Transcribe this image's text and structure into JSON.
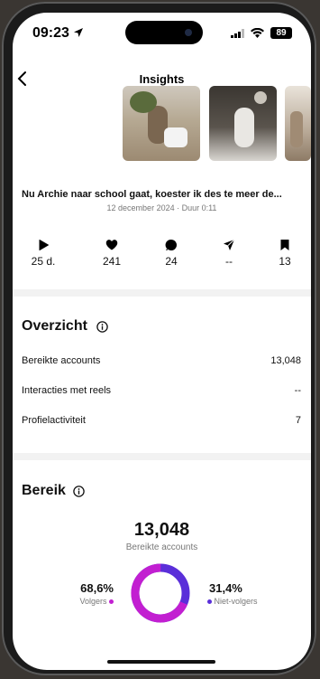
{
  "status_bar": {
    "time": "09:23",
    "battery": "89"
  },
  "nav": {
    "title": "Insights"
  },
  "post": {
    "title": "Nu Archie naar school gaat, koester ik des te meer de...",
    "subtitle": "12 december 2024 · Duur 0:11"
  },
  "stats": [
    {
      "icon": "play-icon",
      "value": "25 d."
    },
    {
      "icon": "heart-icon",
      "value": "241"
    },
    {
      "icon": "comment-icon",
      "value": "24"
    },
    {
      "icon": "share-icon",
      "value": "--"
    },
    {
      "icon": "bookmark-icon",
      "value": "13"
    }
  ],
  "overview": {
    "title": "Overzicht",
    "rows": [
      {
        "label": "Bereikte accounts",
        "value": "13,048"
      },
      {
        "label": "Interacties met reels",
        "value": "--"
      },
      {
        "label": "Profielactiviteit",
        "value": "7"
      }
    ]
  },
  "reach": {
    "title": "Bereik",
    "number": "13,048",
    "label": "Bereikte accounts",
    "followers_pct": "68,6%",
    "followers_label": "Volgers",
    "non_followers_pct": "31,4%",
    "non_followers_label": "Niet-volgers",
    "followers_fraction": 0.686,
    "colors": {
      "followers": "#c21fd1",
      "non_followers": "#5a2fd9"
    }
  }
}
